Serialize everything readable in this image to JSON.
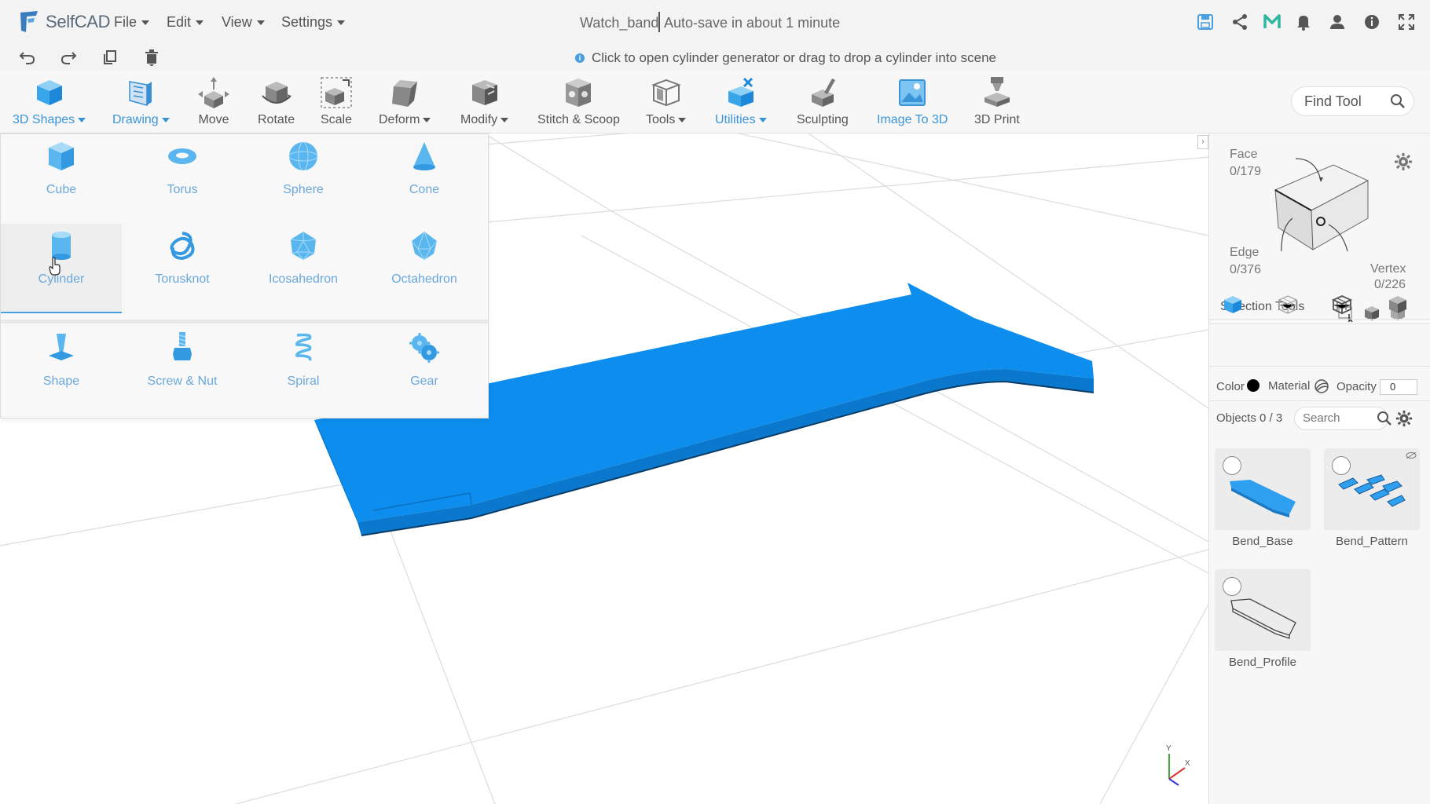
{
  "app": {
    "name": "SelfCAD"
  },
  "menu": [
    {
      "label": "File"
    },
    {
      "label": "Edit"
    },
    {
      "label": "View"
    },
    {
      "label": "Settings"
    }
  ],
  "document": {
    "title": "Watch_band",
    "status": "Auto-save in about 1 minute"
  },
  "hint": "Click to open cylinder generator or drag to drop a cylinder into scene",
  "toolbar": {
    "tools": [
      {
        "label": "3D Shapes",
        "has_menu": true,
        "active": true
      },
      {
        "label": "Drawing",
        "has_menu": true
      },
      {
        "label": "Move"
      },
      {
        "label": "Rotate"
      },
      {
        "label": "Scale"
      },
      {
        "label": "Deform",
        "has_menu": true
      },
      {
        "label": "Modify",
        "has_menu": true
      },
      {
        "label": "Stitch & Scoop"
      },
      {
        "label": "Tools",
        "has_menu": true
      },
      {
        "label": "Utilities",
        "has_menu": true
      },
      {
        "label": "Sculpting"
      },
      {
        "label": "Image To 3D"
      },
      {
        "label": "3D Print"
      }
    ],
    "find_tool_placeholder": "Find Tool"
  },
  "shapes_menu": {
    "basic": [
      {
        "label": "Cube"
      },
      {
        "label": "Torus"
      },
      {
        "label": "Sphere"
      },
      {
        "label": "Cone"
      },
      {
        "label": "Cylinder",
        "selected": true
      },
      {
        "label": "Torusknot"
      },
      {
        "label": "Icosahedron"
      },
      {
        "label": "Octahedron"
      }
    ],
    "generators": [
      {
        "label": "Shape"
      },
      {
        "label": "Screw & Nut"
      },
      {
        "label": "Spiral"
      },
      {
        "label": "Gear"
      }
    ]
  },
  "selection": {
    "face_label": "Face",
    "face_count": "0/179",
    "edge_label": "Edge",
    "edge_count": "0/376",
    "vertex_label": "Vertex",
    "vertex_count": "0/226",
    "tools_label": "Selection Tools"
  },
  "properties": {
    "color_label": "Color",
    "color_value": "#000000",
    "material_label": "Material",
    "opacity_label": "Opacity",
    "opacity_value": "0"
  },
  "objects": {
    "header": "Objects 0 / 3",
    "search_placeholder": "Search",
    "items": [
      {
        "name": "Bend_Base"
      },
      {
        "name": "Bend_Pattern"
      },
      {
        "name": "Bend_Profile"
      }
    ]
  },
  "scene": {
    "model_color": "#0d8eee",
    "axis_labels": {
      "y": "Y",
      "x": "X"
    }
  }
}
